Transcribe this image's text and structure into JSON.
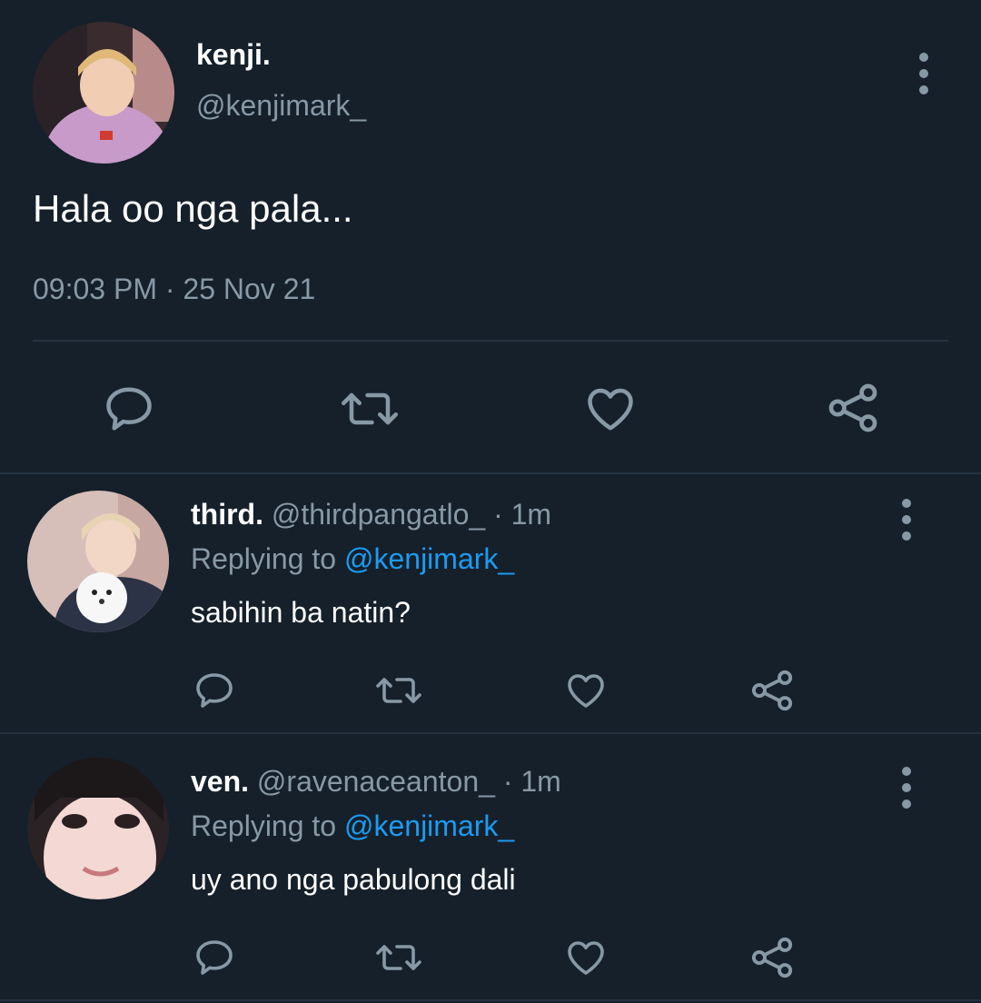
{
  "colors": {
    "background": "#15202b",
    "muted": "#8899a6",
    "link": "#1d9bf0",
    "divider": "#253341"
  },
  "main_tweet": {
    "display_name": "kenji.",
    "handle": "@kenjimark_",
    "text": "Hala oo nga pala...",
    "timestamp": "09:03 PM · 25 Nov 21",
    "actions": [
      "reply-icon",
      "retweet-icon",
      "like-icon",
      "share-icon"
    ]
  },
  "replies": [
    {
      "display_name": "third.",
      "handle": "@thirdpangatlo_",
      "time": "· 1m",
      "replying_label": "Replying to",
      "replying_to": "@kenjimark_",
      "text": "sabihin ba natin?"
    },
    {
      "display_name": "ven.",
      "handle": "@ravenaceanton_",
      "time": "· 1m",
      "replying_label": "Replying to",
      "replying_to": "@kenjimark_",
      "text": "uy ano nga pabulong dali"
    }
  ]
}
